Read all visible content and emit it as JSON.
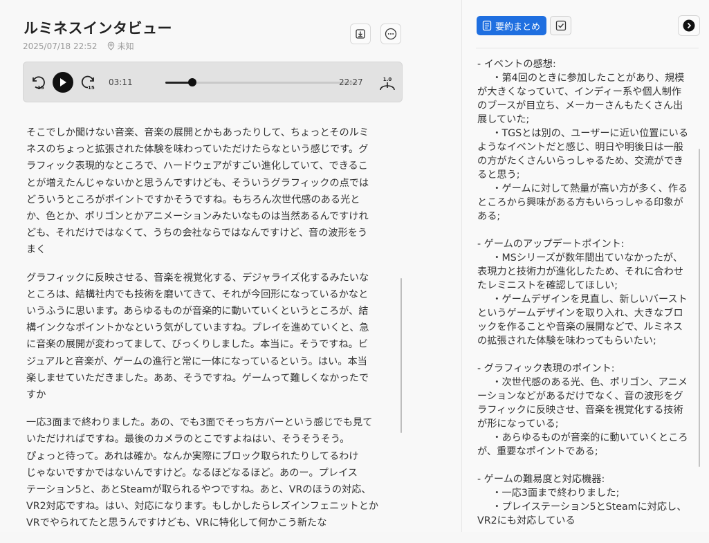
{
  "header": {
    "title": "ルミネスインタビュー",
    "datetime": "2025/07/18 22:52",
    "location": "未知"
  },
  "player": {
    "rewind_seconds": "15",
    "forward_seconds": "15",
    "current_time": "03:11",
    "total_time": "22:27",
    "progress_fraction": 0.142,
    "speed": "1.0"
  },
  "transcript": [
    "そこでしか聞けない音楽、音楽の展開とかもあったりして、ちょっとそのルミ\nネスのちょっと拡張された体験を味わっていただけたらなという感じです。グ\nラフィック表現的なところで、ハードウェアがすごい進化していて、できるこ\nとが増えたんじゃないかと思うんですけども、そういうグラフィックの点では\nどういうところがポイントですかそうですね。もちろん次世代感のある光と\nか、色とか、ポリゴンとかアニメーションみたいなものは当然あるんですけれ\nども、それだけではなくて、うちの会社ならではなんですけど、音の波形をう\nまく",
    "グラフィックに反映させる、音楽を視覚化する、デジャライズ化するみたいな\nところは、結構社内でも技術を磨いてきて、それが今回形になっているかなと\nいうふうに思います。あらゆるものが音楽的に動いていくというところが、結\n構インクなポイントかなという気がしていますね。プレイを進めていくと、急\nに音楽の展開が変わってまして、びっくりしました。本当に。そうですね。ビ\nジュアルと音楽が、ゲームの進行と常に一体になっているという。はい。本当\n楽しませていただきました。ああ、そうですね。ゲームって難しくなかったで\nすか",
    "一応3面まで終わりました。あの、でも3面でそっち方バーという感じでも見て\nいただければですね。最後のカメラのとこですよねはい、そうそうそう。\nぴょっと待って。あれは確か。なんか実際にブロック取られたりしてるわけ\nじゃないですかではないんですけど。なるほどなるほど。あのー。プレイス\nテーション5と、あとSteamが取られるやつですね。あと、VRのほうの対応、\nVR2対応ですね。はい、対応になります。もしかしたらレズインフェニットとか\nVRでやられてたと思うんですけども、VRに特化して何かこう新たな"
  ],
  "summary_panel": {
    "summary_tab_label": "要約まとめ",
    "sections": [
      {
        "heading": "- イベントの感想:",
        "items": [
          "・第4回のときに参加したことがあり、規模が大きくなっていて、インディー系や個人制作のブースが目立ち、メーカーさんもたくさん出展していた;",
          "・TGSとは別の、ユーザーに近い位置にいるようなイベントだと感じ、明日や明後日は一般の方がたくさんいらっしゃるため、交流ができると思う;",
          "・ゲームに対して熱量が高い方が多く、作るところから興味がある方もいらっしゃる印象がある;"
        ]
      },
      {
        "heading": "- ゲームのアップデートポイント:",
        "items": [
          "・MSシリーズが数年間出ていなかったが、表現力と技術力が進化したため、それに合わせたレミニストを確認してほしい;",
          "・ゲームデザインを見直し、新しいバーストというゲームデザインを取り入れ、大きなブロックを作ることや音楽の展開などで、ルミネスの拡張された体験を味わってもらいたい;"
        ]
      },
      {
        "heading": "- グラフィック表現のポイント:",
        "items": [
          "・次世代感のある光、色、ポリゴン、アニメーションなどがあるだけでなく、音の波形をグラフィックに反映させ、音楽を視覚化する技術が形になっている;",
          "・あらゆるものが音楽的に動いていくところが、重要なポイントである;"
        ]
      },
      {
        "heading": "- ゲームの難易度と対応機器:",
        "items": [
          "・一応3面まで終わりました;",
          "・プレイステーション5とSteamに対応し、VR2にも対応している"
        ]
      }
    ]
  }
}
